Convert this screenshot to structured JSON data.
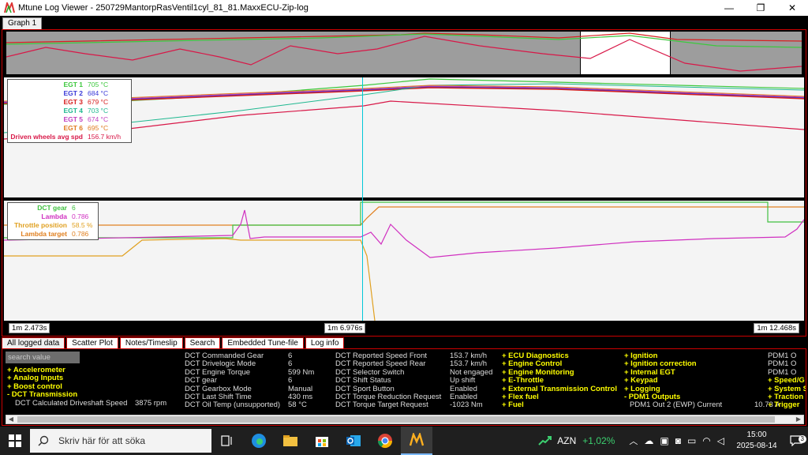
{
  "window": {
    "title": "Mtune Log Viewer - 250729MantorpRasVentil1cyl_81_81.MaxxECU-Zip-log",
    "minimize": "—",
    "maximize": "❐",
    "close": "✕"
  },
  "graph_tab": "Graph 1",
  "graph1_legend": [
    {
      "name": "EGT 1",
      "value": "705 °C",
      "color": "#3dc83d"
    },
    {
      "name": "EGT 2",
      "value": "684 °C",
      "color": "#3a3ad8"
    },
    {
      "name": "EGT 3",
      "value": "679 °C",
      "color": "#d82020"
    },
    {
      "name": "EGT 4",
      "value": "703 °C",
      "color": "#1fb890"
    },
    {
      "name": "EGT 5",
      "value": "674 °C",
      "color": "#c040c0"
    },
    {
      "name": "EGT 6",
      "value": "695 °C",
      "color": "#e07a20"
    },
    {
      "name": "Driven wheels avg spd",
      "value": "156.7 km/h",
      "color": "#d81848"
    }
  ],
  "graph2_legend": [
    {
      "name": "DCT gear",
      "value": "6",
      "color": "#40c040"
    },
    {
      "name": "Lambda",
      "value": "0.786",
      "color": "#d030c0"
    },
    {
      "name": "Throttle position",
      "value": "58.5 %",
      "color": "#e0a020"
    },
    {
      "name": "Lambda target",
      "value": "0.786",
      "color": "#e08020"
    }
  ],
  "time_axis": {
    "start": "1m 2.473s",
    "cursor": "1m 6.976s",
    "end": "1m 12.468s"
  },
  "bottom_tabs": [
    "All logged data",
    "Scatter Plot",
    "Notes/Timeslip",
    "Search",
    "Embedded Tune-file",
    "Log info"
  ],
  "search": {
    "placeholder": "search value"
  },
  "categories_col1": [
    "+ Accelerometer",
    "+ Analog Inputs",
    "+ Boost control",
    "- DCT Transmission"
  ],
  "dct_calculated": {
    "name": "DCT Calculated Driveshaft Speed",
    "value": "3875 rpm"
  },
  "dct_col_a": [
    {
      "name": "DCT Commanded Gear",
      "value": "6"
    },
    {
      "name": "DCT Drivelogic Mode",
      "value": "6"
    },
    {
      "name": "DCT Engine Torque",
      "value": "599 Nm"
    },
    {
      "name": "DCT gear",
      "value": "6"
    },
    {
      "name": "DCT Gearbox Mode",
      "value": "Manual"
    },
    {
      "name": "DCT Last Shift Time",
      "value": "430 ms"
    },
    {
      "name": "DCT Oil Temp (unsupported)",
      "value": "58 °C"
    }
  ],
  "dct_col_b": [
    {
      "name": "DCT Reported Speed Front",
      "value": "153.7 km/h"
    },
    {
      "name": "DCT Reported Speed Rear",
      "value": "153.7 km/h"
    },
    {
      "name": "DCT Selector Switch",
      "value": "Not engaged"
    },
    {
      "name": "DCT Shift Status",
      "value": "Up shift"
    },
    {
      "name": "DCT Sport Button",
      "value": "Enabled"
    },
    {
      "name": "DCT Torque Reduction Request",
      "value": "Enabled"
    },
    {
      "name": "DCT Torque Target Request",
      "value": "-1023 Nm"
    }
  ],
  "categories_col3": [
    "+ ECU Diagnostics",
    "+ Engine Control",
    "+ Engine Monitoring",
    "+ E-Throttle",
    "+ External Transmission Control",
    "+ Flex fuel",
    "+ Fuel"
  ],
  "categories_col4": [
    "+ Ignition",
    "+ Ignition correction",
    "+ Internal EGT",
    "+ Keypad",
    "+ Logging",
    "- PDM1 Outputs"
  ],
  "pdm1_out2": {
    "name": "PDM1 Out 2 (EWP) Current",
    "value": "10.73 A"
  },
  "col5": [
    "PDM1 O",
    "PDM1 O",
    "PDM1 O",
    "+ Speed/G",
    "+ System S",
    "+ Traction",
    "+ Trigger"
  ],
  "taskbar": {
    "search_placeholder": "Skriv här för att söka",
    "stock_symbol": "AZN",
    "stock_change": "+1,02%",
    "time": "15:00",
    "date": "2025-08-14",
    "notifications": "3"
  },
  "colors": {
    "accent_red": "#cc0000",
    "highlight_yellow": "#ffff00",
    "stock_green": "#3cd070"
  }
}
